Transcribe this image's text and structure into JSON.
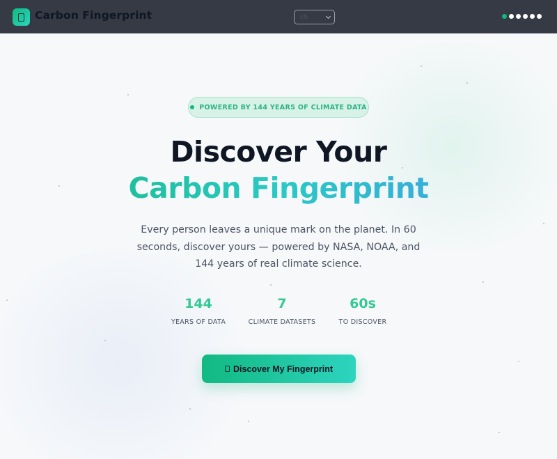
{
  "header": {
    "app_name": "Carbon Fingerprint",
    "logo_icon": "fingerprint-icon",
    "language": {
      "selected": "EN"
    },
    "steps": {
      "count": 6,
      "active_index": 0
    }
  },
  "hero": {
    "badge": "POWERED BY 144 YEARS OF CLIMATE DATA",
    "title_line1": "Discover Your",
    "title_line2": "Carbon Fingerprint",
    "description": "Every person leaves a unique mark on the planet. In 60 seconds, discover yours — powered by NASA, NOAA, and 144 years of real climate science.",
    "stats": [
      {
        "value": "144",
        "label": "YEARS OF DATA"
      },
      {
        "value": "7",
        "label": "CLIMATE DATASETS"
      },
      {
        "value": "60s",
        "label": "TO DISCOVER"
      }
    ],
    "cta": {
      "label": "Discover My Fingerprint",
      "icon": "fingerprint-icon"
    }
  },
  "colors": {
    "header_bg": "#353a45",
    "accent": "#10b981",
    "accent_teal": "#2dd4bf",
    "accent_blue": "#4098ea",
    "title_dark": "#0f1724"
  }
}
